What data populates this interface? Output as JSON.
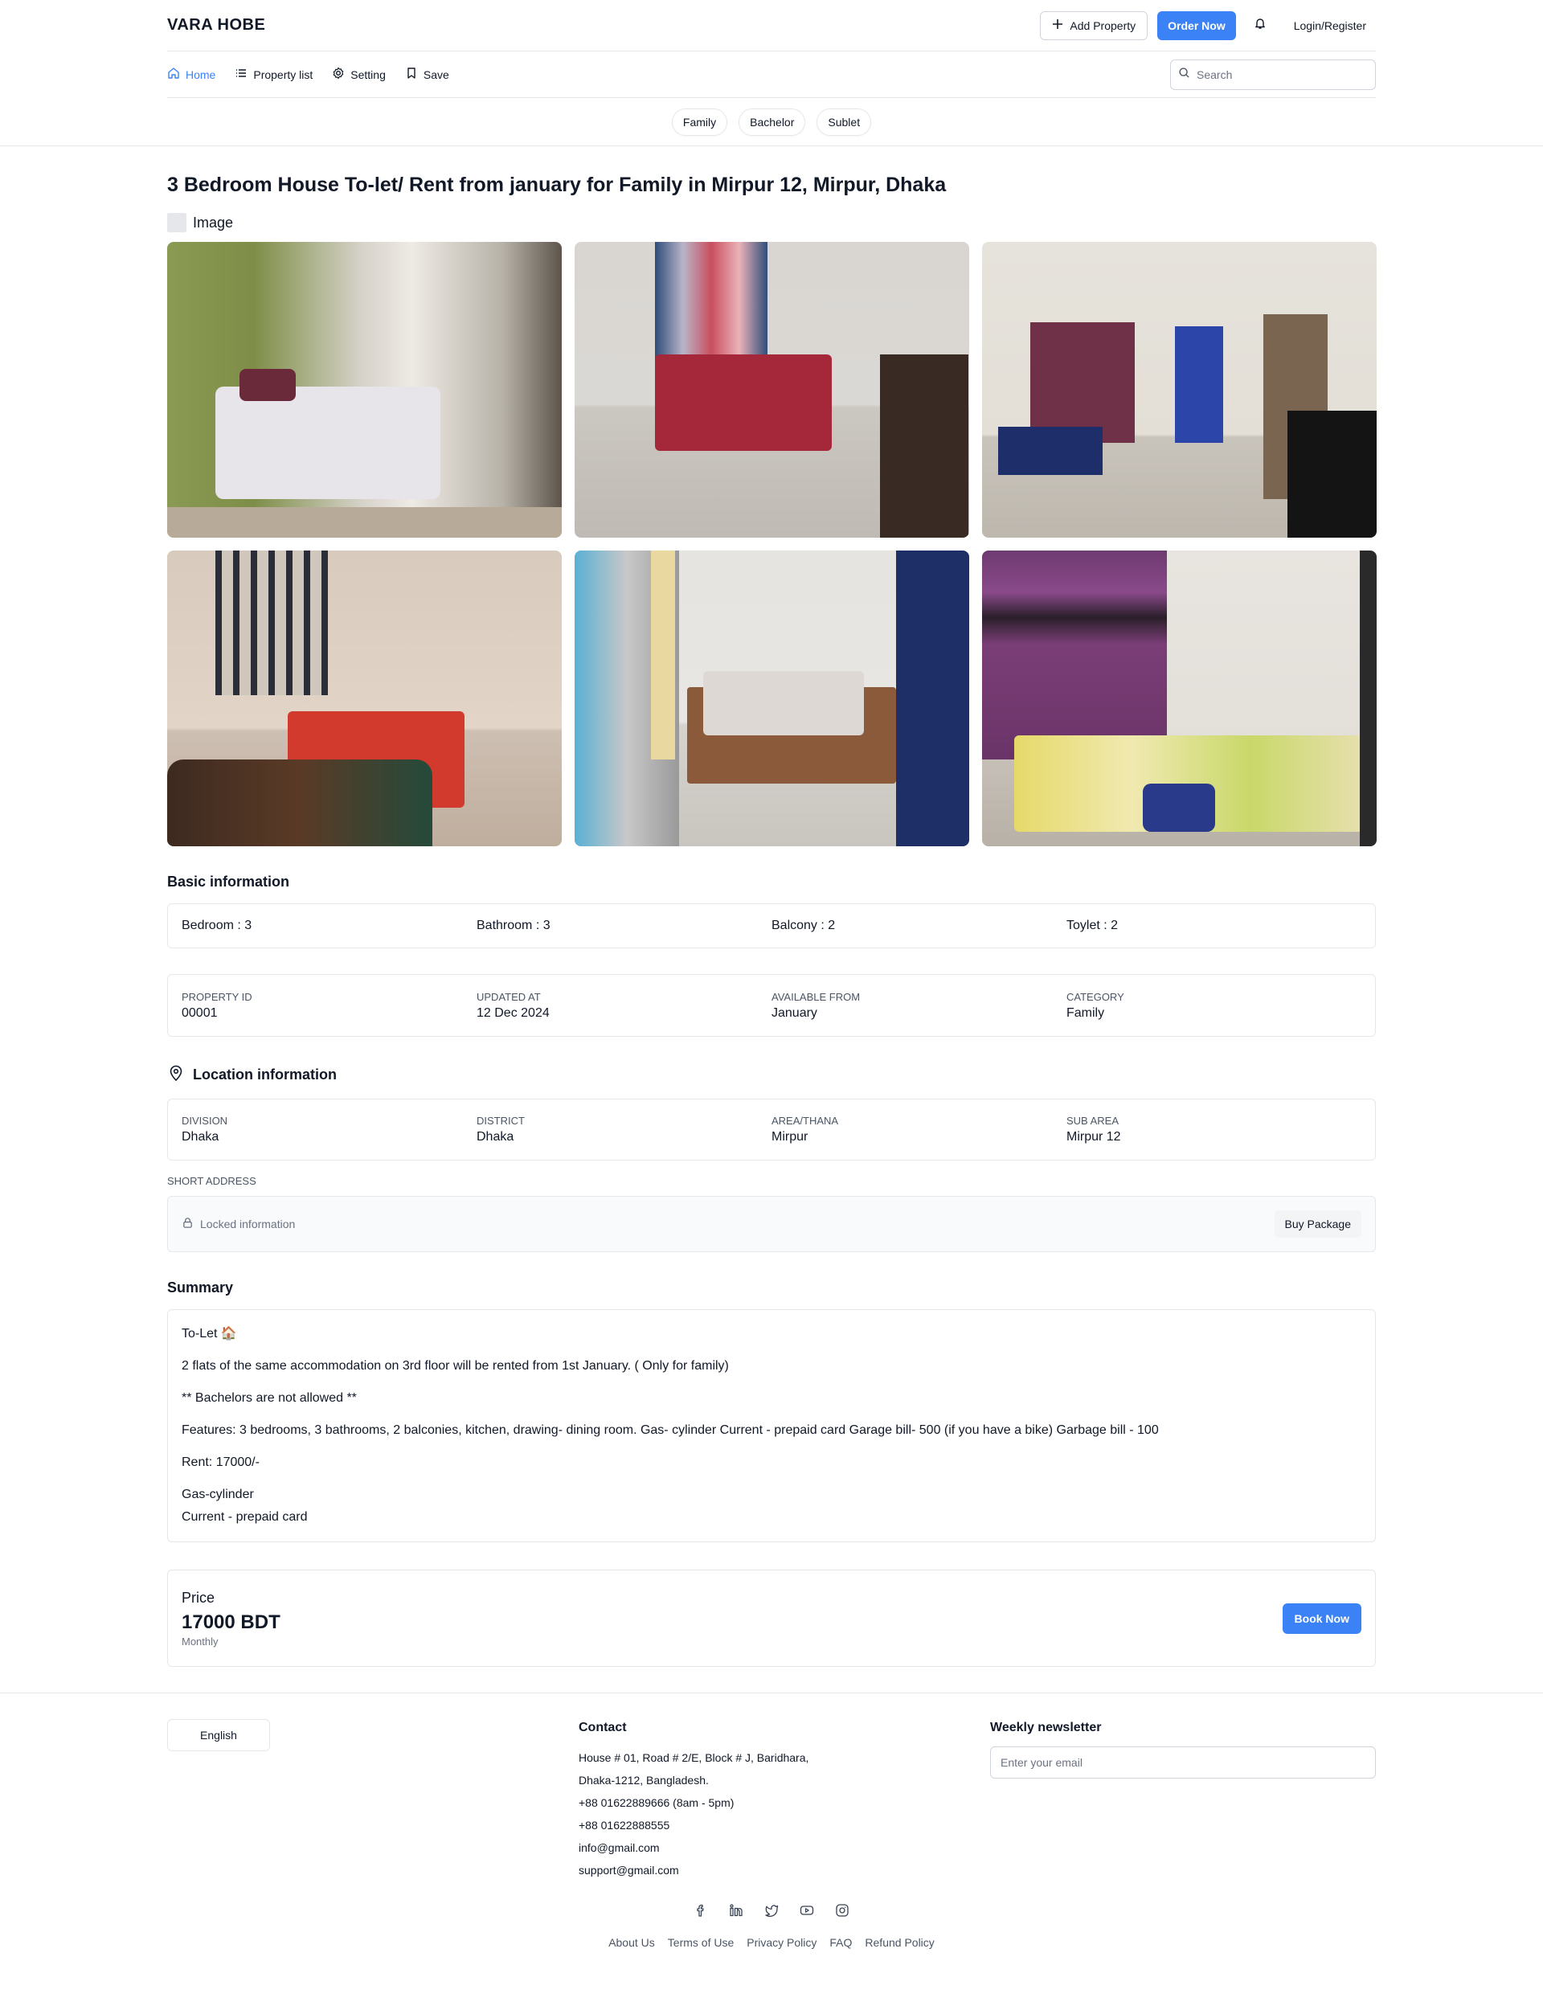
{
  "header": {
    "brand": "VARA HOBE",
    "add_property": "Add Property",
    "order_now": "Order Now",
    "login": "Login/Register"
  },
  "nav": {
    "items": [
      {
        "label": "Home",
        "icon": "home-icon"
      },
      {
        "label": "Property list",
        "icon": "list-icon"
      },
      {
        "label": "Setting",
        "icon": "gear-icon"
      },
      {
        "label": "Save",
        "icon": "bookmark-icon"
      }
    ],
    "search_placeholder": "Search"
  },
  "categories": [
    "Family",
    "Bachelor",
    "Sublet"
  ],
  "listing": {
    "title": "3 Bedroom House To-let/ Rent from january for Family in Mirpur 12, Mirpur, Dhaka",
    "image_label": "Image"
  },
  "basic": {
    "title": "Basic information",
    "items": [
      "Bedroom : 3",
      "Bathroom : 3",
      "Balcony : 2",
      "Toylet : 2"
    ]
  },
  "meta": [
    {
      "key": "PROPERTY ID",
      "value": "00001"
    },
    {
      "key": "UPDATED AT",
      "value": "12 Dec 2024"
    },
    {
      "key": "AVAILABLE FROM",
      "value": "January"
    },
    {
      "key": "CATEGORY",
      "value": "Family"
    }
  ],
  "location": {
    "title": "Location information",
    "fields": [
      {
        "key": "DIVISION",
        "value": "Dhaka"
      },
      {
        "key": "DISTRICT",
        "value": "Dhaka"
      },
      {
        "key": "AREA/THANA",
        "value": "Mirpur"
      },
      {
        "key": "SUB AREA",
        "value": "Mirpur 12"
      }
    ],
    "short_address_label": "SHORT ADDRESS",
    "locked_text": "Locked information",
    "buy_package": "Buy Package"
  },
  "summary": {
    "title": "Summary",
    "lines": [
      "To-Let 🏠",
      "2 flats of the same accommodation on 3rd floor will be rented from 1st January. ( Only for family)",
      "** Bachelors are not allowed **",
      "Features: 3 bedrooms, 3 bathrooms, 2 balconies, kitchen, drawing- dining room. Gas- cylinder Current - prepaid card Garage bill- 500 (if you have a bike) Garbage bill - 100",
      "Rent: 17000/-",
      "Gas-cylinder",
      "Current - prepaid card"
    ]
  },
  "price": {
    "label": "Price",
    "value": "17000 BDT",
    "period": "Monthly",
    "book": "Book Now"
  },
  "footer": {
    "language": "English",
    "contact_title": "Contact",
    "contact_lines": [
      "House # 01, Road # 2/E, Block # J, Baridhara,",
      "Dhaka-1212, Bangladesh.",
      "+88 01622889666 (8am - 5pm)",
      "+88 01622888555",
      "info@gmail.com",
      "support@gmail.com"
    ],
    "newsletter_title": "Weekly newsletter",
    "newsletter_placeholder": "Enter your email",
    "socials": [
      "facebook-icon",
      "linkedin-icon",
      "twitter-icon",
      "youtube-icon",
      "instagram-icon"
    ],
    "links": [
      "About Us",
      "Terms of Use",
      "Privacy Policy",
      "FAQ",
      "Refund Policy"
    ]
  },
  "colors": {
    "accent": "#3b82f6",
    "border": "#e5e7eb",
    "muted": "#6b7280"
  }
}
